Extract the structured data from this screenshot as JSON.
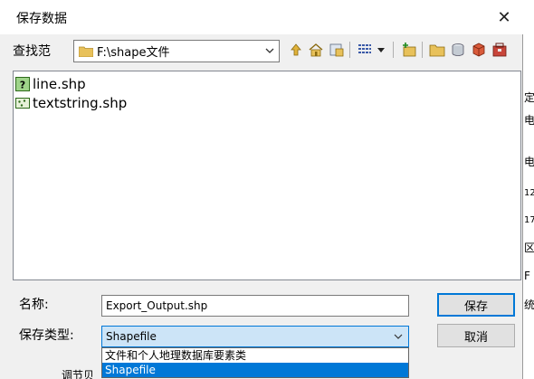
{
  "dialog": {
    "title": "保存数据",
    "close_glyph": "✕"
  },
  "lookin": {
    "label": "查找范",
    "path": "F:\\shape文件"
  },
  "toolbar": {
    "icons": [
      "up-folder-icon",
      "home-icon",
      "connect-folder-icon",
      "view-list-icon",
      "view-dropdown-icon",
      "new-item-icon",
      "new-folder-icon",
      "database-icon",
      "geodatabase-icon",
      "toolbox-icon"
    ]
  },
  "files": [
    {
      "name": "line.shp",
      "icon": "line-feature-icon"
    },
    {
      "name": "textstring.shp",
      "icon": "point-feature-icon"
    }
  ],
  "name_field": {
    "label": "名称:",
    "value": "Export_Output.shp"
  },
  "type_field": {
    "label": "保存类型:",
    "value": "Shapefile",
    "options": [
      "文件和个人地理数据库要素类",
      "Shapefile"
    ]
  },
  "buttons": {
    "save": "保存",
    "cancel": "取消"
  },
  "background": {
    "fragments": [
      "定",
      "电",
      "电",
      "12",
      "17",
      "区",
      "F",
      "统"
    ],
    "bottom": "调节贝"
  },
  "colors": {
    "accent": "#0078d7",
    "selection": "#cce4f7"
  }
}
